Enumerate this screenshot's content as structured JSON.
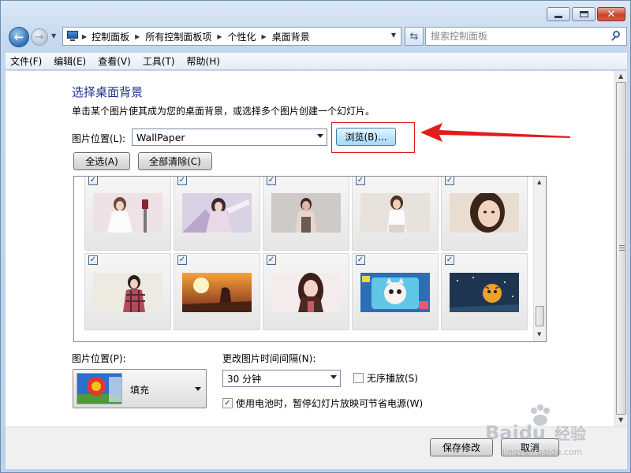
{
  "window": {
    "caption_buttons": {
      "minimize": "minimize",
      "maximize": "maximize",
      "close": "✕"
    }
  },
  "nav": {
    "breadcrumbs": [
      "控制面板",
      "所有控制面板项",
      "个性化",
      "桌面背景"
    ],
    "search_placeholder": "搜索控制面板"
  },
  "menu": {
    "items": [
      "文件(F)",
      "编辑(E)",
      "查看(V)",
      "工具(T)",
      "帮助(H)"
    ]
  },
  "page": {
    "title": "选择桌面背景",
    "description": "单击某个图片使其成为您的桌面背景，或选择多个图片创建一个幻灯片。",
    "picture_location_label": "图片位置(L):",
    "picture_location_value": "WallPaper",
    "browse_label": "浏览(B)...",
    "select_all_label": "全选(A)",
    "clear_all_label": "全部清除(C)"
  },
  "thumbnails": [
    {
      "checked": true,
      "theme": "woman-white-dress"
    },
    {
      "checked": true,
      "theme": "fantasy-woman"
    },
    {
      "checked": true,
      "theme": "man-grey"
    },
    {
      "checked": true,
      "theme": "woman-white-top"
    },
    {
      "checked": true,
      "theme": "woman-portrait"
    },
    {
      "checked": true,
      "theme": "woman-plaid-shirt"
    },
    {
      "checked": true,
      "theme": "sunset-silhouette"
    },
    {
      "checked": true,
      "theme": "woman-long-hair"
    },
    {
      "checked": true,
      "theme": "cartoon-cat"
    },
    {
      "checked": true,
      "theme": "cartoon-tiger"
    }
  ],
  "options": {
    "position_label": "图片位置(P):",
    "position_value": "填充",
    "interval_label": "更改图片时间间隔(N):",
    "interval_value": "30 分钟",
    "shuffle_label": "无序播放(S)",
    "shuffle_checked": false,
    "battery_label": "使用电池时，暂停幻灯片放映可节省电源(W)",
    "battery_checked": true
  },
  "footer": {
    "save_label": "保存修改",
    "cancel_label": "取消"
  },
  "colors": {
    "title_blue": "#1e3287",
    "highlight_red": "#e21b1b"
  },
  "watermark": {
    "brand": "Baidu",
    "suffix": "经验",
    "url": "jingyan.baidu.com"
  }
}
